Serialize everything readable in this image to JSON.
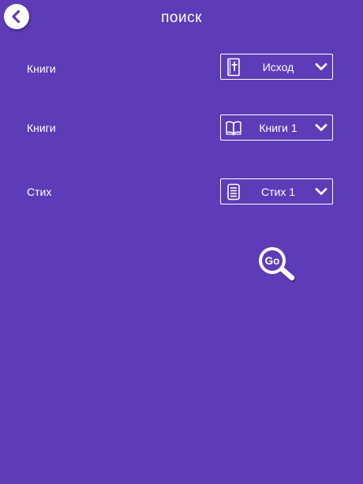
{
  "header": {
    "title": "поиск",
    "back_icon": "chevron-left-icon"
  },
  "form": {
    "rows": [
      {
        "label": "Книги",
        "value": "Исход",
        "icon": "bible-cross-icon"
      },
      {
        "label": "Книги",
        "value": "Книги 1",
        "icon": "open-book-icon"
      },
      {
        "label": "Стих",
        "value": "Стих 1",
        "icon": "document-icon"
      }
    ]
  },
  "go_button": {
    "text": "Go",
    "icon": "magnifier-icon"
  },
  "colors": {
    "background": "#5e3cb8",
    "foreground": "#ffffff"
  }
}
